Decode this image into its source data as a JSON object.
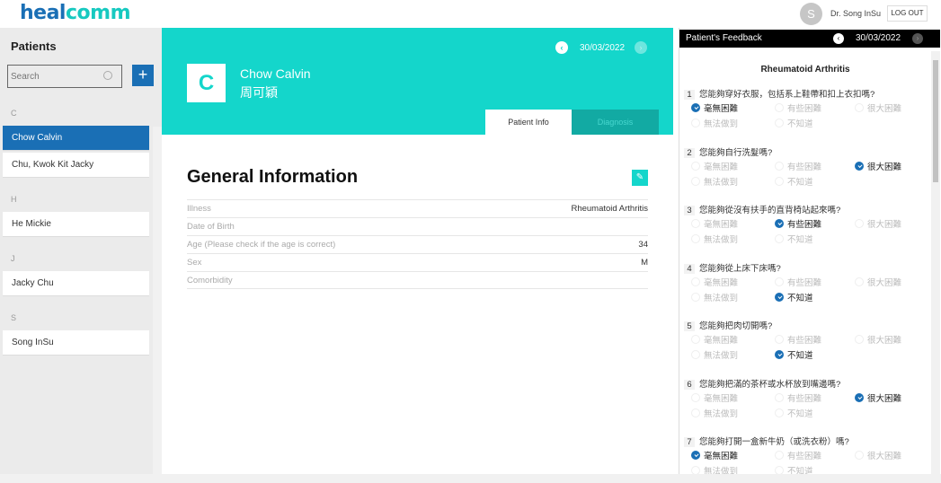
{
  "header": {
    "logo_a": "heal",
    "logo_b": "comm",
    "avatar_letter": "S",
    "doctor": "Dr. Song InSu",
    "logout": "LOG OUT"
  },
  "sidebar": {
    "title": "Patients",
    "search_placeholder": "Search",
    "add": "+",
    "groups": [
      {
        "letter": "C",
        "items": [
          "Chow Calvin",
          "Chu, Kwok Kit Jacky"
        ]
      },
      {
        "letter": "H",
        "items": [
          "He Mickie"
        ]
      },
      {
        "letter": "J",
        "items": [
          "Jacky Chu"
        ]
      },
      {
        "letter": "S",
        "items": [
          "Song InSu"
        ]
      }
    ]
  },
  "patient": {
    "initial": "C",
    "name": "Chow Calvin",
    "name_cn": "周可穎",
    "date": "30/03/2022",
    "prev": "‹",
    "next": "›",
    "tabs": [
      "Patient Info",
      "Diagnosis"
    ]
  },
  "general": {
    "title": "General Information",
    "edit_icon": "✎",
    "rows": [
      {
        "label": "Illness",
        "value": "Rheumatoid Arthritis"
      },
      {
        "label": "Date of Birth",
        "value": ""
      },
      {
        "label": "Age (Please check if the age is correct)",
        "value": "34"
      },
      {
        "label": "Sex",
        "value": "M"
      },
      {
        "label": "Comorbidity",
        "value": ""
      }
    ]
  },
  "feedback": {
    "title": "Patient's Feedback",
    "date": "30/03/2022",
    "illness": "Rheumatoid Arthritis",
    "options": [
      "毫無困難",
      "有些困難",
      "很大困難",
      "無法做到",
      "不知道"
    ],
    "questions": [
      {
        "n": "1",
        "text": "您能夠穿好衣服，包括系上鞋帶和扣上衣扣嗎?",
        "selected": 0
      },
      {
        "n": "2",
        "text": "您能夠自行洗髮嗎?",
        "selected": 2
      },
      {
        "n": "3",
        "text": "您能夠從沒有扶手的直背椅站起來嗎?",
        "selected": 1
      },
      {
        "n": "4",
        "text": "您能夠從上床下床嗎?",
        "selected": 4
      },
      {
        "n": "5",
        "text": "您能夠把肉切開嗎?",
        "selected": 4
      },
      {
        "n": "6",
        "text": "您能夠把滿的茶杯或水杯放到嘴邊嗎?",
        "selected": 2
      },
      {
        "n": "7",
        "text": "您能夠打開一盒新牛奶（或洗衣粉）嗎?",
        "selected": 0
      }
    ]
  }
}
